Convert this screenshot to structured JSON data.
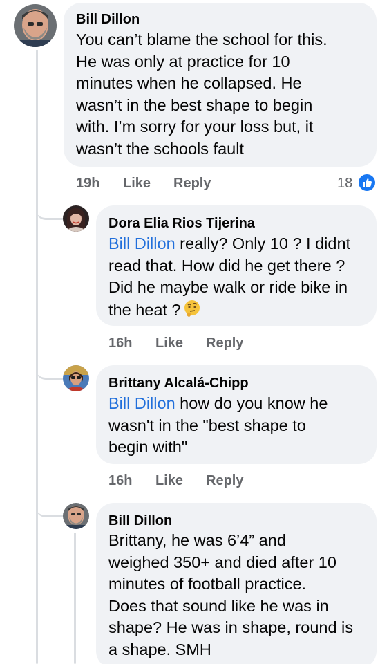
{
  "comments": [
    {
      "author": "Bill Dillon",
      "avatar": "bearded-man-avatar",
      "lines": [
        "You can’t blame the school for this.",
        "He was only at practice for 10",
        "minutes when he collapsed. He",
        "wasn’t in the best shape to begin",
        "with. I’m sorry for your loss but, it",
        "wasn’t the schools fault"
      ],
      "time": "19h",
      "like_label": "Like",
      "reply_label": "Reply",
      "reaction_count": "18",
      "reaction_icon": "thumbs-up-icon"
    },
    {
      "author": "Dora Elia Rios Tijerina",
      "avatar": "woman-avatar",
      "mention": "Bill Dillon",
      "lines": [
        " really? Only 10 ? I didnt",
        "read that.  How did he get there ?",
        "Did he maybe walk or ride bike in",
        "the heat ?"
      ],
      "emoji": "thinking-face-emoji",
      "time": "16h",
      "like_label": "Like",
      "reply_label": "Reply"
    },
    {
      "author": "Brittany Alcalá-Chipp",
      "avatar": "woman-sunglasses-avatar",
      "mention": "Bill Dillon",
      "lines": [
        " how do you know he",
        "wasn't in the \"best shape to",
        "begin with\""
      ],
      "time": "16h",
      "like_label": "Like",
      "reply_label": "Reply"
    },
    {
      "author": "Bill Dillon",
      "avatar": "bearded-man-avatar",
      "lines": [
        "Brittany, he was 6’4” and",
        "weighed 350+ and died after 10",
        "minutes of football practice.",
        "Does that sound like he was in",
        "shape? He was in shape, round is",
        "a shape. SMH"
      ]
    }
  ],
  "colors": {
    "bubble": "#f0f2f5",
    "mention": "#216fdb",
    "meta": "#65676b",
    "like_blue": "#1877f2"
  }
}
